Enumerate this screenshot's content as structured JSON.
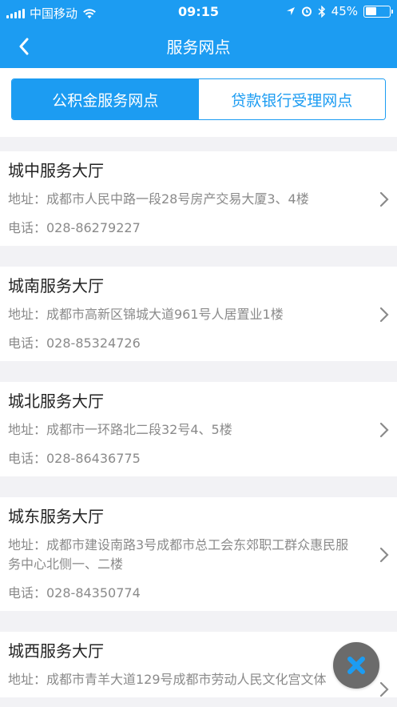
{
  "status_bar": {
    "carrier": "中国移动",
    "time": "09:15",
    "battery_text": "45%",
    "battery_level": 0.45
  },
  "nav": {
    "title": "服务网点",
    "back_icon": "chevron-left-icon"
  },
  "tabs": [
    {
      "label": "公积金服务网点",
      "active": true
    },
    {
      "label": "贷款银行受理网点",
      "active": false
    }
  ],
  "branches": [
    {
      "name": "城中服务大厅",
      "address": "地址：成都市人民中路一段28号房产交易大厦3、4楼",
      "phone": "电话：028-86279227"
    },
    {
      "name": "城南服务大厅",
      "address": "地址：成都市高新区锦城大道961号人居置业1楼",
      "phone": "电话：028-85324726"
    },
    {
      "name": "城北服务大厅",
      "address": "地址：成都市一环路北二段32号4、5楼",
      "phone": "电话：028-86436775"
    },
    {
      "name": "城东服务大厅",
      "address": "地址：成都市建设南路3号成都市总工会东郊职工群众惠民服务中心北侧一、二楼",
      "phone": "电话：028-84350774"
    },
    {
      "name": "城西服务大厅",
      "address": "地址：成都市青羊大道129号成都市劳动人民文化宫文体",
      "phone": ""
    }
  ],
  "fab": {
    "icon": "close-icon"
  },
  "colors": {
    "accent": "#1c9cf2",
    "fab": "#6b6b6b"
  }
}
